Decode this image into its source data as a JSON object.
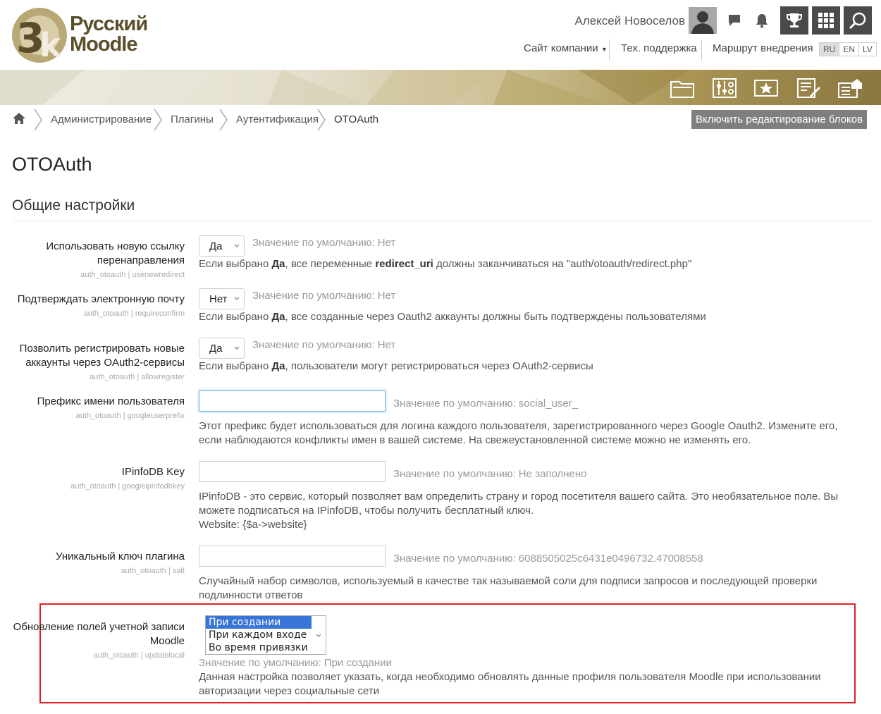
{
  "header": {
    "logo_line1": "Русский",
    "logo_line2": "Moodle",
    "user_name": "Алексей Новоселов",
    "nav": {
      "company": "Сайт компании",
      "support": "Тех. поддержка",
      "route": "Маршрут внедрения"
    },
    "languages": [
      "RU",
      "EN",
      "LV"
    ],
    "active_language": "RU"
  },
  "breadcrumb": {
    "items": [
      "Администрирование",
      "Плагины",
      "Аутентификация",
      "OTOAuth"
    ]
  },
  "edit_blocks_button": "Включить редактирование блоков",
  "page_title": "OTOAuth",
  "section_title": "Общие настройки",
  "settings": {
    "redirect": {
      "label": "Использовать новую ссылку перенаправления",
      "key": "auth_otoauth | usenewredirect",
      "value": "Да",
      "default": "Значение по умолчанию: Нет",
      "desc_pre": "Если выбрано ",
      "desc_bold1": "Да",
      "desc_mid": ", все переменные ",
      "desc_bold2": "redirect_uri",
      "desc_post": " должны заканчиваться на \"auth/otoauth/redirect.php\""
    },
    "confirm": {
      "label": "Подтверждать электронную почту",
      "key": "auth_otoauth | requireconfirm",
      "value": "Нет",
      "default": "Значение по умолчанию: Нет",
      "desc_pre": "Если выбрано ",
      "desc_bold": "Да",
      "desc_post": ", все созданные через Oauth2 аккаунты должны быть подтверждены пользователями"
    },
    "register": {
      "label": "Позволить регистрировать новые аккаунты через OAuth2-сервисы",
      "key": "auth_otoauth | allowregister",
      "value": "Да",
      "default": "Значение по умолчанию: Нет",
      "desc_pre": "Если выбрано ",
      "desc_bold": "Да",
      "desc_post": ", пользователи могут регистрироваться через OAuth2-сервисы"
    },
    "prefix": {
      "label": "Префикс имени пользователя",
      "key": "auth_otoauth | googleuserprefix",
      "value": "",
      "default": "Значение по умолчанию: social_user_",
      "desc": "Этот префикс будет использоваться для логина каждого пользователя, зарегистрированного через Google Oauth2. Измените его, если наблюдаются конфликты имен в вашей системе. На свежеустановленной системе можно не изменять его."
    },
    "ipinfodb": {
      "label": "IPinfoDB Key",
      "key": "auth_otoauth | googleipinfodbkey",
      "value": "",
      "default": "Значение по умолчанию: Не заполнено",
      "desc": "IPinfoDB - это сервис, который позволяет вам определить страну и город посетителя вашего сайта. Это необязательное поле. Вы можете подписаться на IPinfoDB, чтобы получить бесплатный ключ.",
      "desc2": "Website: {$a->website}"
    },
    "salt": {
      "label": "Уникальный ключ плагина",
      "key": "auth_otoauth | salt",
      "value": "",
      "default": "Значение по умолчанию: 6088505025c6431e0496732.47008558",
      "desc": "Случайный набор символов, используемый в качестве так называемой соли для подписи запросов и последующей проверки подлинности ответов"
    },
    "update": {
      "label": "Обновление полей учетной записи Moodle",
      "key": "auth_otoauth | updatelocal",
      "options": [
        "При создании",
        "При каждом входе",
        "Во время привязки"
      ],
      "selected": "При создании",
      "default": "Значение по умолчанию: При создании",
      "desc": "Данная настройка позволяет указать, когда необходимо обновлять данные профиля пользователя Moodle при использовании авторизации через социальные сети"
    }
  },
  "colors": {
    "highlight_border": "#e02020",
    "edit_button_bg": "#7f7f7f",
    "header_button_bg": "#4a4a4a",
    "selected_option_bg": "#3875d7"
  }
}
